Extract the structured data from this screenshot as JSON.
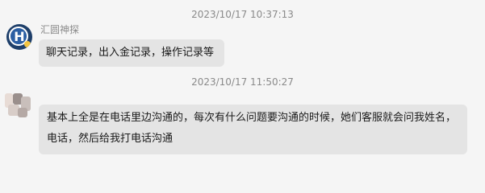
{
  "messages": [
    {
      "timestamp": "2023/10/17 10:37:13",
      "sender": "汇圆神探",
      "avatar_icon": "h-logo-icon",
      "text": "聊天记录，出入金记录，操作记录等"
    },
    {
      "timestamp": "2023/10/17 11:50:27",
      "sender": "",
      "avatar_icon": "blurred-avatar-icon",
      "text": "基本上全是在电话里边沟通的，每次有什么问题要沟通的时候，她们客服就会问我姓名，电话，然后给我打电话沟通"
    }
  ],
  "colors": {
    "background": "#f5f5f5",
    "bubble": "#e4e4e4",
    "timestamp_text": "#8a8a8a",
    "avatar_bg": "#1e3f6a"
  }
}
